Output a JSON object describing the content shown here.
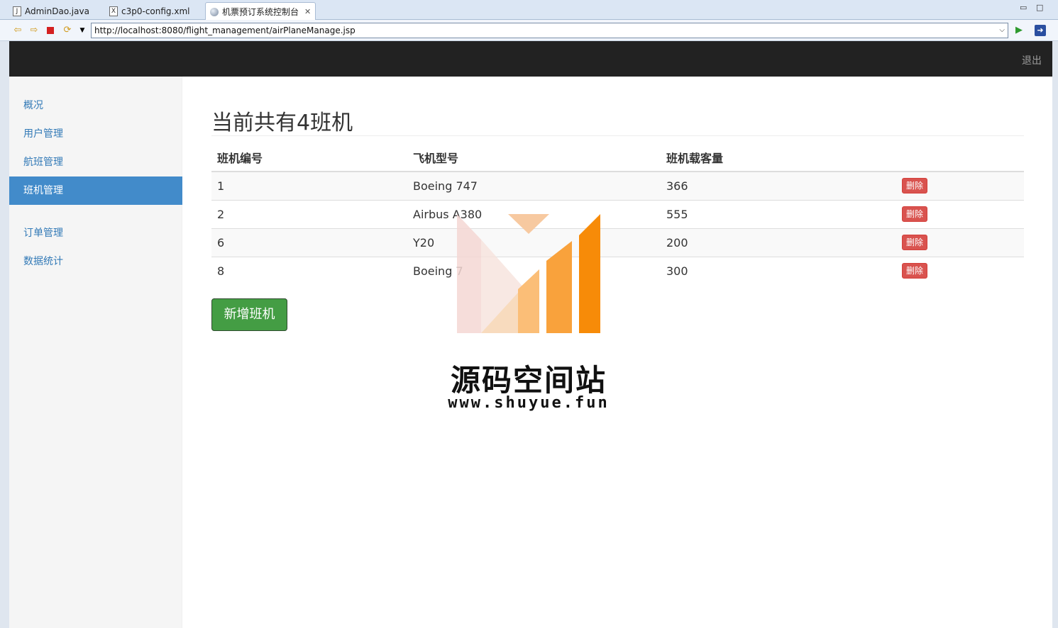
{
  "editor_tabs": [
    {
      "label": "AdminDao.java",
      "icon": "java-file-icon"
    },
    {
      "label": "c3p0-config.xml",
      "icon": "xml-file-icon"
    },
    {
      "label": "机票预订系统控制台",
      "icon": "globe-icon"
    }
  ],
  "address_bar": {
    "url": "http://localhost:8080/flight_management/airPlaneManage.jsp"
  },
  "navbar": {
    "logout": "退出"
  },
  "sidebar": {
    "items": [
      {
        "label": "概况",
        "active": false
      },
      {
        "label": "用户管理",
        "active": false
      },
      {
        "label": "航班管理",
        "active": false
      },
      {
        "label": "班机管理",
        "active": true
      },
      {
        "label": "订单管理",
        "active": false
      },
      {
        "label": "数据统计",
        "active": false
      }
    ]
  },
  "main": {
    "title": "当前共有4班机",
    "table": {
      "headers": [
        "班机编号",
        "飞机型号",
        "班机载客量",
        ""
      ],
      "rows": [
        {
          "id": "1",
          "model": "Boeing 747",
          "capacity": "366",
          "action": "删除"
        },
        {
          "id": "2",
          "model": "Airbus A380",
          "capacity": "555",
          "action": "删除"
        },
        {
          "id": "6",
          "model": "Y20",
          "capacity": "200",
          "action": "删除"
        },
        {
          "id": "8",
          "model": "Boeing 7",
          "capacity": "300",
          "action": "删除"
        }
      ]
    },
    "add_button": "新增班机"
  },
  "watermark": {
    "title": "源码空间站",
    "url": "www.shuyue.fun"
  },
  "colors": {
    "navbar": "#222222",
    "sidebar_active": "#428bca",
    "link": "#337ab7",
    "danger": "#d9534f",
    "success": "#449d44"
  }
}
